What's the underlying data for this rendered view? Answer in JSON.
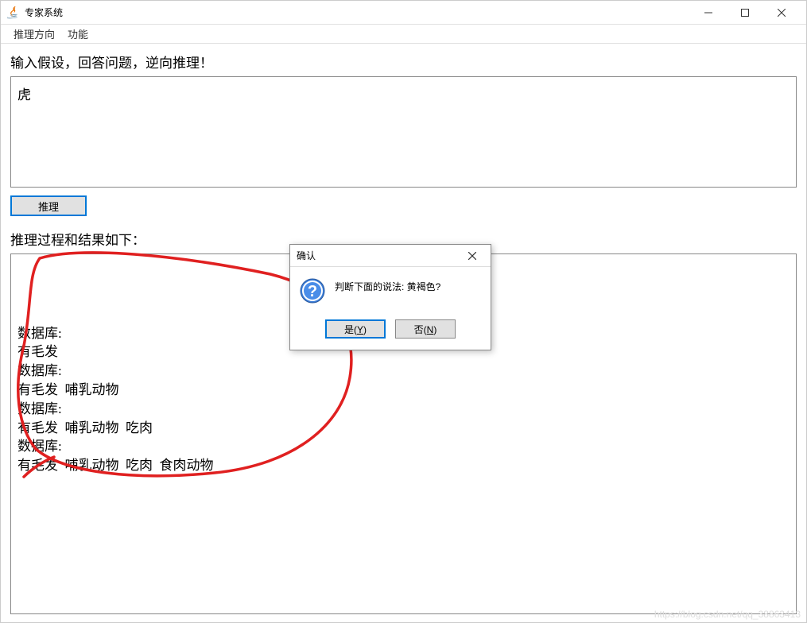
{
  "window": {
    "title": "专家系统"
  },
  "menubar": {
    "items": [
      "推理方向",
      "功能"
    ]
  },
  "input": {
    "label": "输入假设，回答问题，逆向推理！",
    "value": "虎"
  },
  "button": {
    "inference": "推理"
  },
  "result": {
    "label": "推理过程和结果如下：",
    "content": "数据库:\n有毛发\n数据库:\n有毛发  哺乳动物\n数据库:\n有毛发  哺乳动物  吃肉\n数据库:\n有毛发  哺乳动物  吃肉  食肉动物"
  },
  "dialog": {
    "title": "确认",
    "message": "判断下面的说法: 黄褐色?",
    "yes": "是(Y)",
    "no": "否(N)"
  },
  "watermark": "https://blog.csdn.net/qq_38863413"
}
